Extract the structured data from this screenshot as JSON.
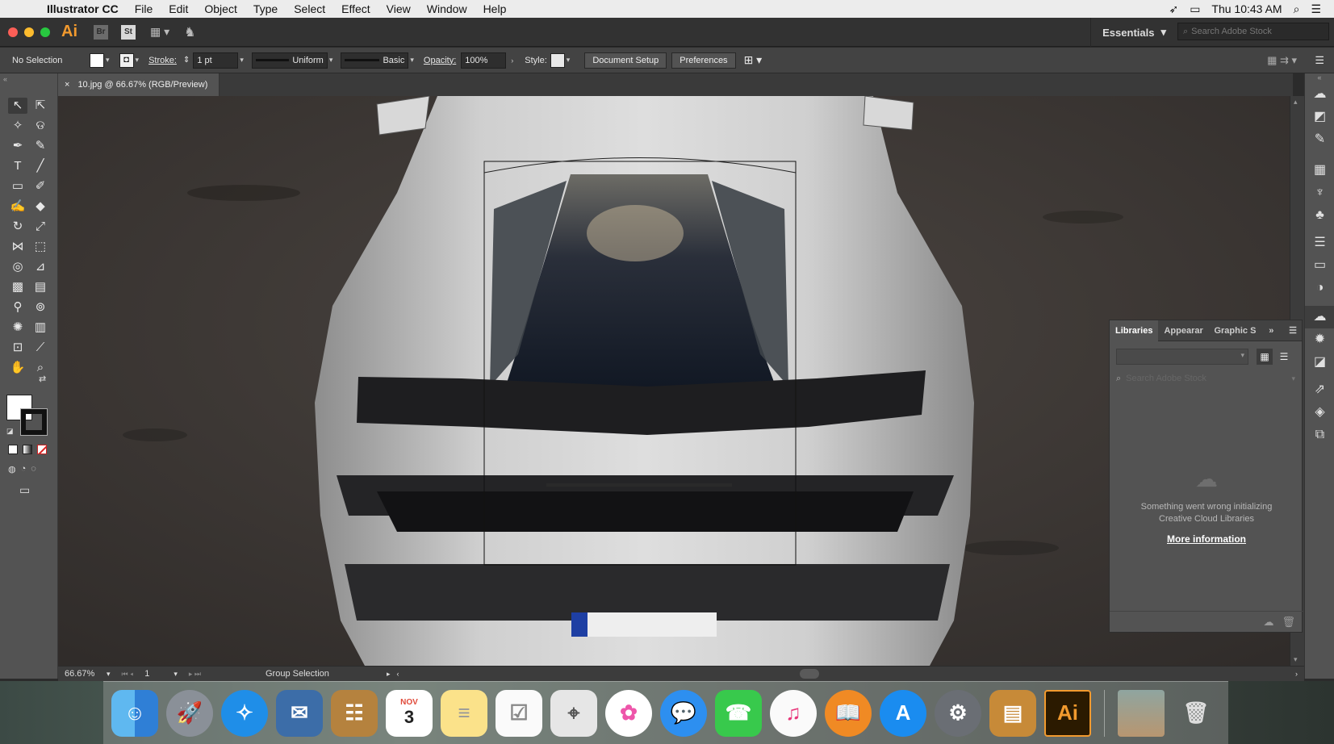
{
  "menubar": {
    "app_name": "Illustrator CC",
    "items": [
      "File",
      "Edit",
      "Object",
      "Type",
      "Select",
      "Effect",
      "View",
      "Window",
      "Help"
    ],
    "clock": "Thu 10:43 AM"
  },
  "appbar": {
    "logo": "Ai",
    "bridge": "Br",
    "stock": "St",
    "workspace": "Essentials",
    "stock_search_placeholder": "Search Adobe Stock"
  },
  "control": {
    "selection": "No Selection",
    "stroke_label": "Stroke:",
    "stroke_weight": "1 pt",
    "profile": "Uniform",
    "brush": "Basic",
    "opacity_label": "Opacity:",
    "opacity": "100%",
    "style_label": "Style:",
    "doc_setup": "Document Setup",
    "preferences": "Preferences"
  },
  "document": {
    "tab_title": "10.jpg @ 66.67% (RGB/Preview)",
    "zoom": "66.67%",
    "page": "1",
    "status": "Group Selection"
  },
  "libraries": {
    "tabs": [
      "Libraries",
      "Appearar",
      "Graphic S"
    ],
    "search_placeholder": "Search Adobe Stock",
    "error": [
      "Something went wrong initializing",
      "Creative Cloud Libraries"
    ],
    "more": "More information"
  },
  "dock": {
    "calendar_month": "NOV",
    "calendar_day": "3",
    "ai_label": "Ai"
  },
  "colors": {
    "accent_orange": "#f29a2e",
    "panel_bg": "#535353",
    "canvas_bg": "#3a3633",
    "car_body": "#c9c9c9"
  }
}
